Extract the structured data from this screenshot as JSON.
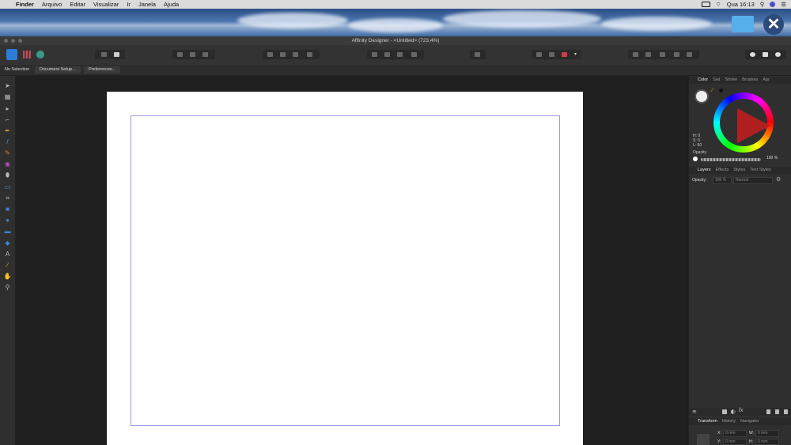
{
  "menubar": {
    "app": "Finder",
    "items": [
      "Arquivo",
      "Editar",
      "Visualizar",
      "Ir",
      "Janela",
      "Ajuda"
    ],
    "clock": "Qua 16:13"
  },
  "window": {
    "title": "Affinity Designer - <Untitled> (723.4%)"
  },
  "context_bar": {
    "selection": "No Selection",
    "document_setup": "Document Setup...",
    "preferences": "Preferences..."
  },
  "color_panel": {
    "tabs": [
      "Color",
      "Swt",
      "Stroke",
      "Brushes",
      "Apr"
    ],
    "h": "H: 0",
    "s": "S: 0",
    "l": "L: 90",
    "opacity_label": "Opacity",
    "opacity_value": "100 %"
  },
  "layers_panel": {
    "tabs": [
      "Layers",
      "Effects",
      "Styles",
      "Text Styles"
    ],
    "opacity_label": "Opacity:",
    "opacity_value": "100 %",
    "blend_mode": "Normal"
  },
  "transform_panel": {
    "tabs": [
      "Transform",
      "History",
      "Navigator"
    ],
    "x": "0 mm",
    "y": "0 mm",
    "w": "0 mm",
    "h": "0 mm",
    "x_label": "X:",
    "y_label": "Y:",
    "w_label": "W:",
    "h_label": "H:"
  },
  "colors": {
    "accent": "#2d7cd6",
    "guide": "#9a9ae0",
    "artboard": "#ffffff"
  }
}
